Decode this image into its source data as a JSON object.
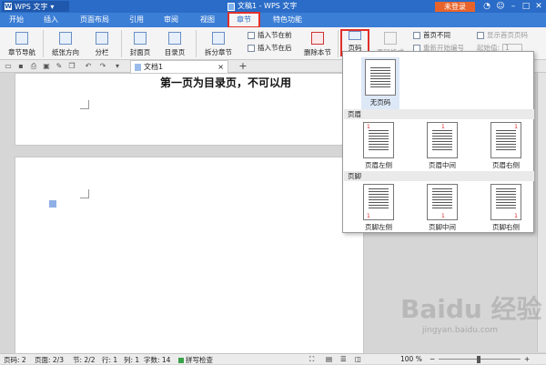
{
  "app": {
    "app_button": "WPS 文字",
    "window_title": "文稿1 - WPS 文字",
    "login_button": "未登录"
  },
  "tabs": [
    {
      "label": "开始"
    },
    {
      "label": "插入"
    },
    {
      "label": "页面布局"
    },
    {
      "label": "引用"
    },
    {
      "label": "审阅"
    },
    {
      "label": "视图"
    },
    {
      "label": "章节",
      "active": true
    },
    {
      "label": "特色功能"
    }
  ],
  "ribbon": {
    "nav": "章节导航",
    "orientation": "纸张方向",
    "columns": "分栏",
    "cover": "封面页",
    "toc": "目录页",
    "split": "拆分章节",
    "insert_before": "插入节在前",
    "insert_after": "插入节在后",
    "delete_section": "删除本节",
    "page_code": "页码",
    "page_format": "页码格式",
    "first_page_diff": "首页不同",
    "show_first_page": "显示首页页码",
    "restart_numbering": "重新开始编号",
    "start_value": "起始值:",
    "start_value_num": "1"
  },
  "document": {
    "tab_title": "文档1",
    "page1_text": "第一页为目录页，不可以用"
  },
  "dropdown": {
    "none_label": "无页码",
    "header_section": "页眉",
    "footer_section": "页脚",
    "header_left": "页眉左侧",
    "header_center": "页眉中间",
    "header_right": "页眉右侧",
    "footer_left": "页脚左侧",
    "footer_center": "页脚中间",
    "footer_right": "页脚右侧",
    "marker": "1"
  },
  "status": {
    "page_num": "页码: 2",
    "pages": "页面: 2/3",
    "section": "节: 2/2",
    "row": "行: 1",
    "col": "列: 1",
    "chars": "字数: 14",
    "spell": "拼写检查",
    "zoom": "100 %"
  },
  "watermark": {
    "main": "Baidu 经验",
    "sub": "jingyan.baidu.com"
  },
  "colors": {
    "title_blue": "#2a6cc7",
    "highlight_red": "#e0302a",
    "login_orange": "#e8632a"
  }
}
